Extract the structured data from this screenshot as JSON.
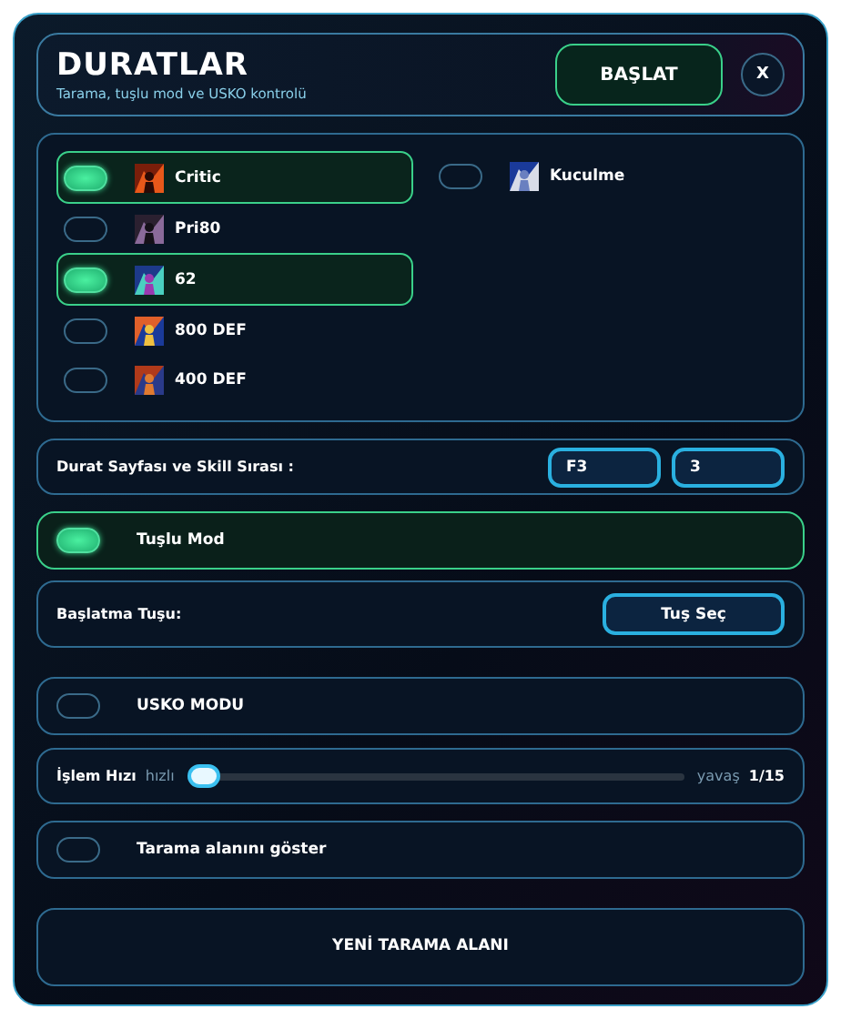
{
  "header": {
    "title": "DURATLAR",
    "subtitle": "Tarama, tuşlu mod ve USKO kontrolü",
    "start_button": "BAŞLAT",
    "close_button": "X"
  },
  "skills": {
    "columns": [
      [
        {
          "label": "Critic",
          "on": true
        },
        {
          "label": "Pri80",
          "on": false
        },
        {
          "label": "62",
          "on": true
        },
        {
          "label": "800 DEF",
          "on": false
        },
        {
          "label": "400 DEF",
          "on": false
        }
      ],
      [
        {
          "label": "Kuculme",
          "on": false
        }
      ]
    ]
  },
  "durat_page": {
    "label": "Durat Sayfası ve Skill Sırası :",
    "page_value": "F3",
    "skill_value": "3"
  },
  "key_mode": {
    "label": "Tuşlu Mod",
    "on": true
  },
  "start_key": {
    "label": "Başlatma Tuşu:",
    "button": "Tuş Seç"
  },
  "usko_mode": {
    "label": "USKO MODU",
    "on": false
  },
  "speed": {
    "label": "İşlem Hızı",
    "min_label": "hızlı",
    "max_label": "yavaş",
    "reading": "1/15",
    "level": 0
  },
  "show_area": {
    "label": "Tarama alanını göster",
    "on": false
  },
  "new_area_button": "YENİ TARAMA ALANI"
}
